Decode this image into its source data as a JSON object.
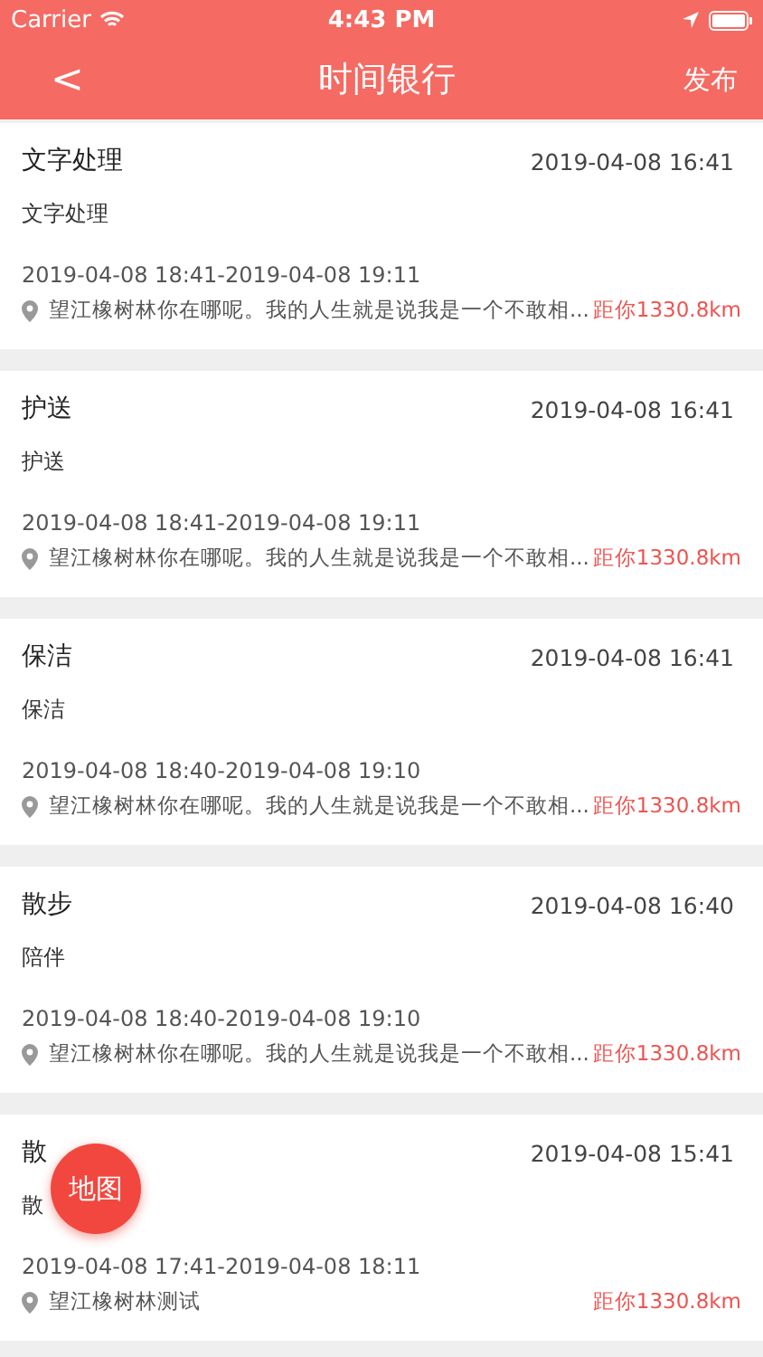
{
  "status_bar": {
    "carrier": "Carrier",
    "time": "4:43 PM"
  },
  "nav": {
    "back": "<",
    "title": "时间银行",
    "action": "发布"
  },
  "posts": [
    {
      "title": "文字处理",
      "posted": "2019-04-08 16:41",
      "description": "文字处理",
      "period": "2019-04-08 18:41-2019-04-08 19:11",
      "location": "望江橡树林你在哪呢。我的人生就是说我是一个不敢相...",
      "distance": "距你1330.8km"
    },
    {
      "title": "护送",
      "posted": "2019-04-08 16:41",
      "description": "护送",
      "period": "2019-04-08 18:41-2019-04-08 19:11",
      "location": "望江橡树林你在哪呢。我的人生就是说我是一个不敢相...",
      "distance": "距你1330.8km"
    },
    {
      "title": "保洁",
      "posted": "2019-04-08 16:41",
      "description": "保洁",
      "period": "2019-04-08 18:40-2019-04-08 19:10",
      "location": "望江橡树林你在哪呢。我的人生就是说我是一个不敢相...",
      "distance": "距你1330.8km"
    },
    {
      "title": "散步",
      "posted": "2019-04-08 16:40",
      "description": "陪伴",
      "period": "2019-04-08 18:40-2019-04-08 19:10",
      "location": "望江橡树林你在哪呢。我的人生就是说我是一个不敢相...",
      "distance": "距你1330.8km"
    },
    {
      "title": "散",
      "posted": "2019-04-08 15:41",
      "description": "散",
      "period": "2019-04-08 17:41-2019-04-08 18:11",
      "location": "望江橡树林测试",
      "distance": "距你1330.8km"
    }
  ],
  "map_button": "地图"
}
